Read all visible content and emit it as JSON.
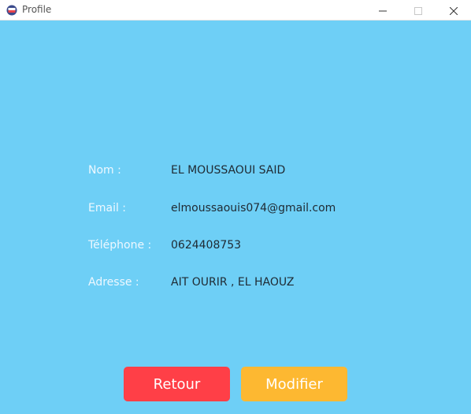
{
  "window": {
    "title": "Profile",
    "app_icon": "profile-app-icon",
    "controls": {
      "minimize_icon": "minimize-icon",
      "maximize_icon": "maximize-icon",
      "close_icon": "close-icon"
    }
  },
  "profile": {
    "nom_label": "Nom :",
    "nom_value": "EL MOUSSAOUI SAID",
    "email_label": "Email :",
    "email_value": "elmoussaouis074@gmail.com",
    "telephone_label": "Téléphone :",
    "telephone_value": "0624408753",
    "adresse_label": "Adresse :",
    "adresse_value": "AIT OURIR , EL HAOUZ"
  },
  "actions": {
    "retour_label": "Retour",
    "modifier_label": "Modifier"
  },
  "colors": {
    "background": "#6ecff6",
    "retour_button": "#ff3f47",
    "modifier_button": "#fdb831"
  }
}
